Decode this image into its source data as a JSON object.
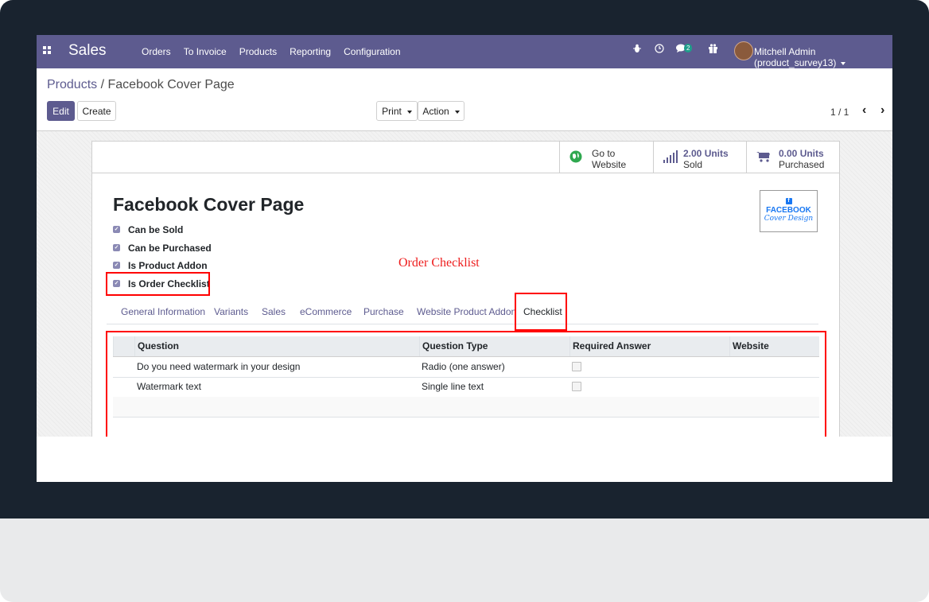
{
  "navbar": {
    "app_name": "Sales",
    "menu": [
      "Orders",
      "To Invoice",
      "Products",
      "Reporting",
      "Configuration"
    ],
    "messages_badge": "2",
    "user": "Mitchell Admin (product_survey13)"
  },
  "breadcrumb": {
    "parent": "Products",
    "separator": "/",
    "current": "Facebook Cover Page"
  },
  "toolbar": {
    "edit": "Edit",
    "create": "Create",
    "print": "Print",
    "action": "Action",
    "pager": "1 / 1"
  },
  "stat_buttons": {
    "website": {
      "line1": "Go to",
      "line2": "Website"
    },
    "sold": {
      "value": "2.00 Units",
      "label": "Sold"
    },
    "purchased": {
      "value": "0.00 Units",
      "label": "Purchased"
    }
  },
  "product": {
    "name": "Facebook Cover Page",
    "logo_line1": "FACEBOOK",
    "logo_line2": "Cover Design",
    "checks": [
      "Can be Sold",
      "Can be Purchased",
      "Is Product Addon",
      "Is Order Checklist"
    ]
  },
  "annotation": "Order Checklist",
  "tabs": [
    "General Information",
    "Variants",
    "Sales",
    "eCommerce",
    "Purchase",
    "Website Product Addon",
    "Checklist"
  ],
  "table": {
    "headers": [
      "Question",
      "Question Type",
      "Required Answer",
      "Website"
    ],
    "rows": [
      {
        "question": "Do you need watermark in your design",
        "type": "Radio (one answer)",
        "required": false
      },
      {
        "question": "Watermark text",
        "type": "Single line text",
        "required": false
      }
    ]
  },
  "colors": {
    "navbar": "#5d5b8f",
    "highlight": "#ff0000",
    "monitor": "#19232f"
  }
}
